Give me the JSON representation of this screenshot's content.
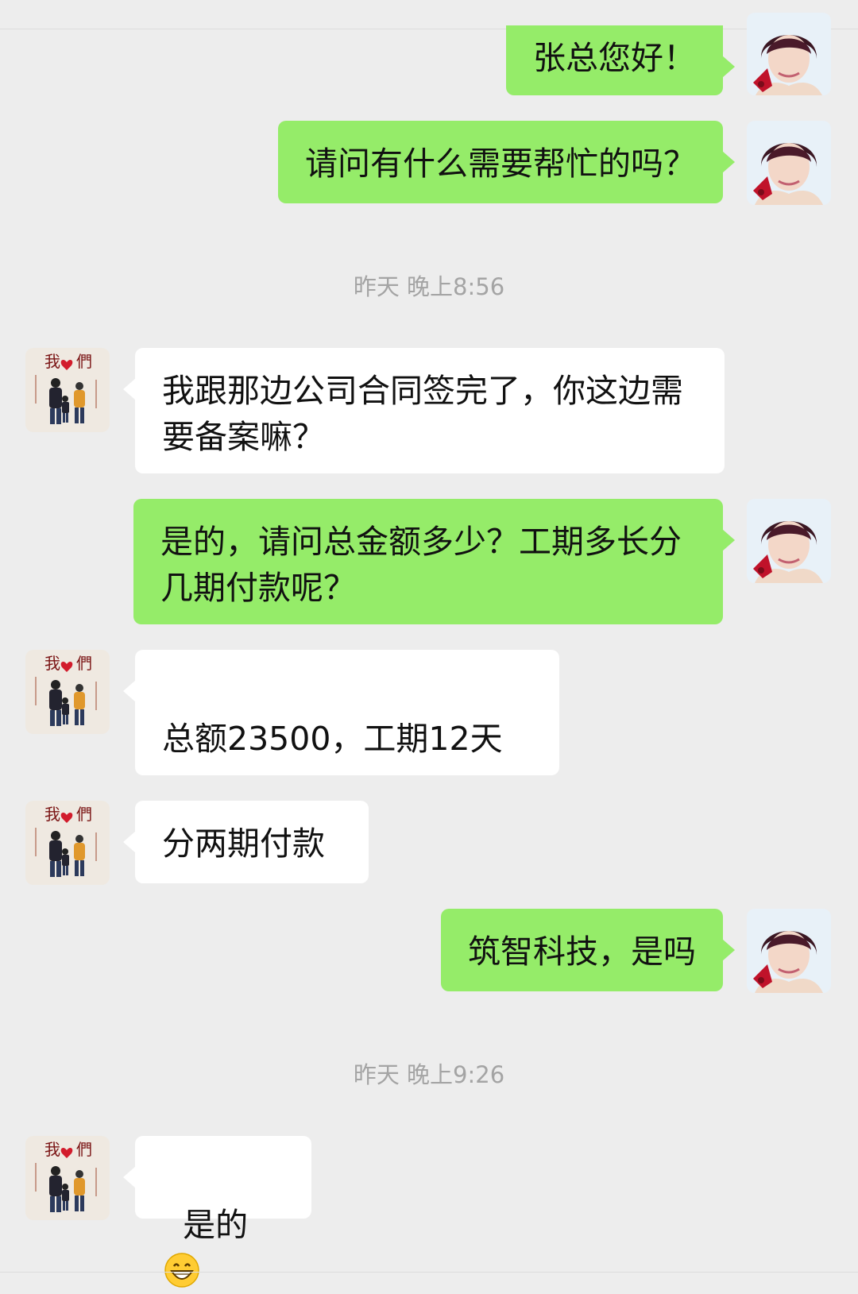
{
  "conversation": {
    "timestamps": [
      "昨天 晚上8:56",
      "昨天 晚上9:26"
    ],
    "messages": [
      {
        "sender": "self",
        "text": "张总您好！"
      },
      {
        "sender": "self",
        "text": "请问有什么需要帮忙的吗？"
      },
      {
        "sender": "other",
        "text": "我跟那边公司合同签完了，你这边需要备案嘛？"
      },
      {
        "sender": "self",
        "text": "是的，请问总金额多少？工期多长分几期付款呢？"
      },
      {
        "sender": "other",
        "text": "\n总额23500，工期12天"
      },
      {
        "sender": "other",
        "text": "分两期付款"
      },
      {
        "sender": "self",
        "text": "筑智科技，是吗"
      },
      {
        "sender": "other",
        "text": "是的",
        "emoji": "grinning-face"
      }
    ]
  },
  "avatars": {
    "other_text_top": "我",
    "other_text_right": "們"
  },
  "colors": {
    "background": "#ededed",
    "outgoing_bubble": "#95ec69",
    "incoming_bubble": "#ffffff",
    "timestamp": "#a4a4a4"
  }
}
